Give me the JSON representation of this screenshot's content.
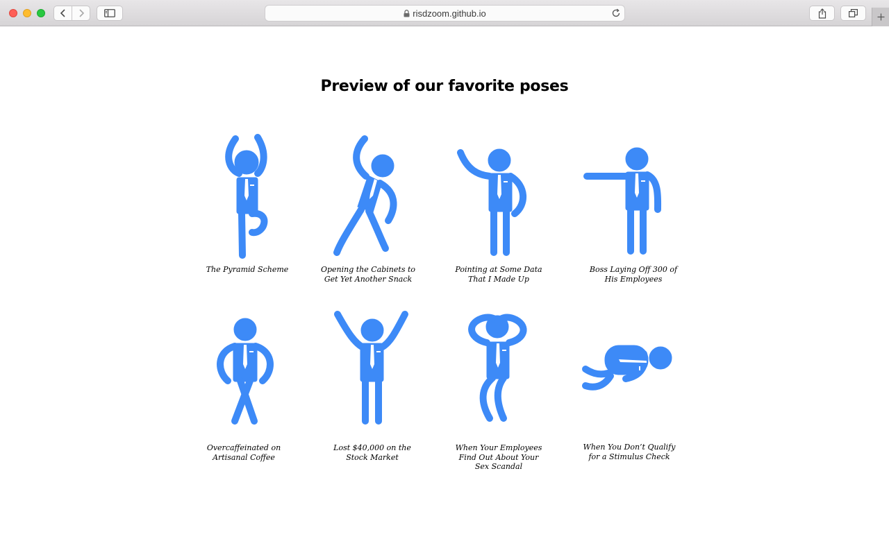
{
  "browser": {
    "url": "risdzoom.github.io"
  },
  "page": {
    "title": "Preview of our favorite poses",
    "poses": [
      {
        "caption": "The Pyramid Scheme"
      },
      {
        "caption": "Opening the Cabinets to\nGet Yet Another Snack"
      },
      {
        "caption": "Pointing at Some Data\nThat I Made Up"
      },
      {
        "caption": "Boss Laying Off 300 of\nHis Employees"
      },
      {
        "caption": "Overcaffeinated on\nArtisanal Coffee"
      },
      {
        "caption": "Lost $40,000 on the\nStock Market"
      },
      {
        "caption": "When Your Employees\nFind Out About Your\nSex Scandal"
      },
      {
        "caption": "When You Don’t Qualify\nfor a Stimulus Check"
      }
    ]
  },
  "colors": {
    "figure": "#3d8af7"
  }
}
